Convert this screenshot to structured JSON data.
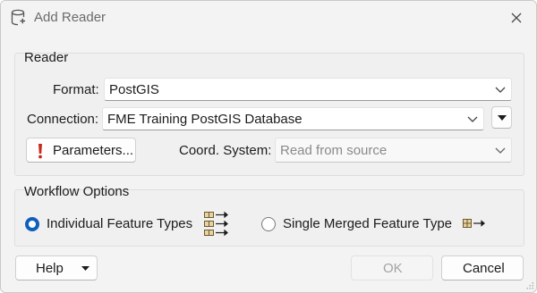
{
  "window": {
    "title": "Add Reader"
  },
  "reader_group": {
    "title": "Reader",
    "format_label": "Format:",
    "format_value": "PostGIS",
    "connection_label": "Connection:",
    "connection_value": "FME Training PostGIS Database",
    "parameters_button": "Parameters...",
    "coord_label": "Coord. System:",
    "coord_value": "Read from source"
  },
  "workflow_group": {
    "title": "Workflow Options",
    "option_individual": "Individual Feature Types",
    "option_individual_selected": true,
    "option_merged": "Single Merged Feature Type",
    "option_merged_selected": false
  },
  "footer": {
    "help_label": "Help",
    "ok_label": "OK",
    "ok_enabled": false,
    "cancel_label": "Cancel"
  },
  "colors": {
    "accent": "#0f5fbd",
    "warning": "#c42b1c"
  }
}
